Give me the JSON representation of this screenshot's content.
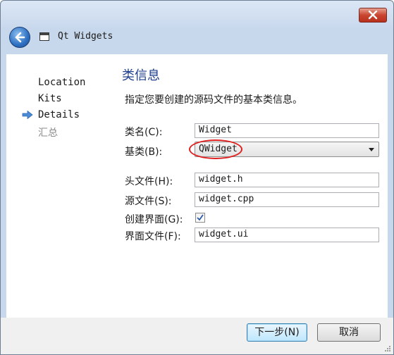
{
  "window": {
    "title": "Qt Widgets",
    "close_icon": "close-icon",
    "back_icon": "back-arrow-icon"
  },
  "sidebar": {
    "items": [
      {
        "label": "Location",
        "state": "done"
      },
      {
        "label": "Kits",
        "state": "done"
      },
      {
        "label": "Details",
        "state": "current"
      },
      {
        "label": "汇总",
        "state": "pending"
      }
    ]
  },
  "page": {
    "title": "类信息",
    "subtitle": "指定您要创建的源码文件的基本类信息。"
  },
  "form": {
    "class_name": {
      "label": "类名(C):",
      "value": "Widget"
    },
    "base_class": {
      "label": "基类(B):",
      "value": "QWidget"
    },
    "header_file": {
      "label": "头文件(H):",
      "value": "widget.h"
    },
    "source_file": {
      "label": "源文件(S):",
      "value": "widget.cpp"
    },
    "generate_form": {
      "label": "创建界面(G):",
      "checked": true
    },
    "form_file": {
      "label": "界面文件(F):",
      "value": "widget.ui"
    }
  },
  "buttons": {
    "next": "下一步(N)",
    "cancel": "取消"
  },
  "colors": {
    "title_blue": "#1e3f8e",
    "highlight_red": "#e02020",
    "arrow_blue": "#4a8ad6"
  }
}
